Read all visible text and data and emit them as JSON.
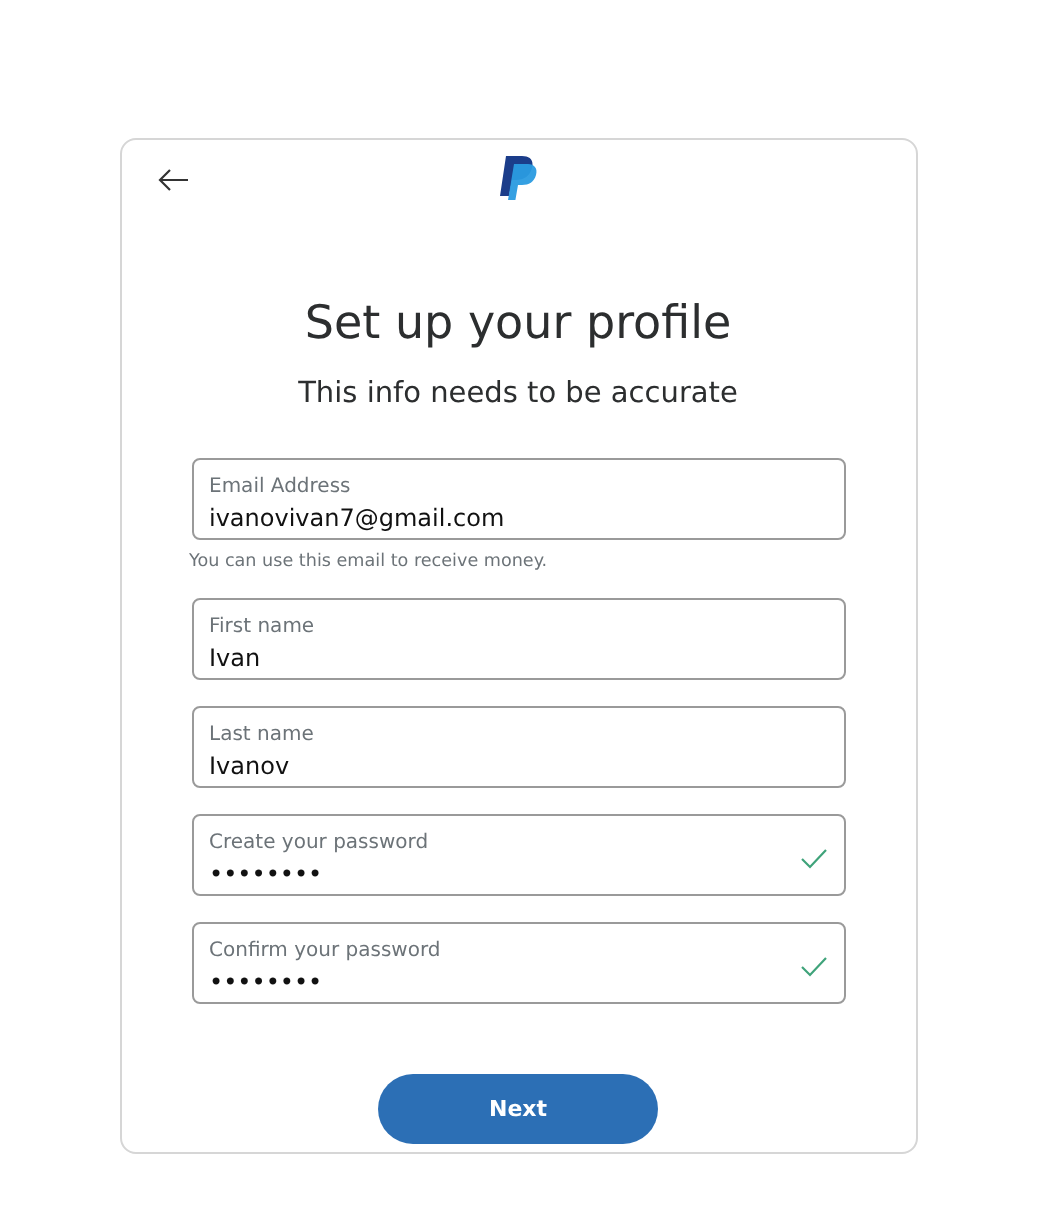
{
  "title": "Set up your profile",
  "subtitle": "This info needs to be accurate",
  "fields": [
    {
      "label": "Email Address",
      "value": "ivanovivan7@gmail.com",
      "valid": false,
      "hint": "You can use this email to receive money."
    },
    {
      "label": "First name",
      "value": "Ivan",
      "valid": false
    },
    {
      "label": "Last name",
      "value": "Ivanov",
      "valid": false
    },
    {
      "label": "Create your password",
      "value": "••••••••",
      "valid": true
    },
    {
      "label": "Confirm your password",
      "value": "••••••••",
      "valid": true
    }
  ],
  "next_button": "Next"
}
